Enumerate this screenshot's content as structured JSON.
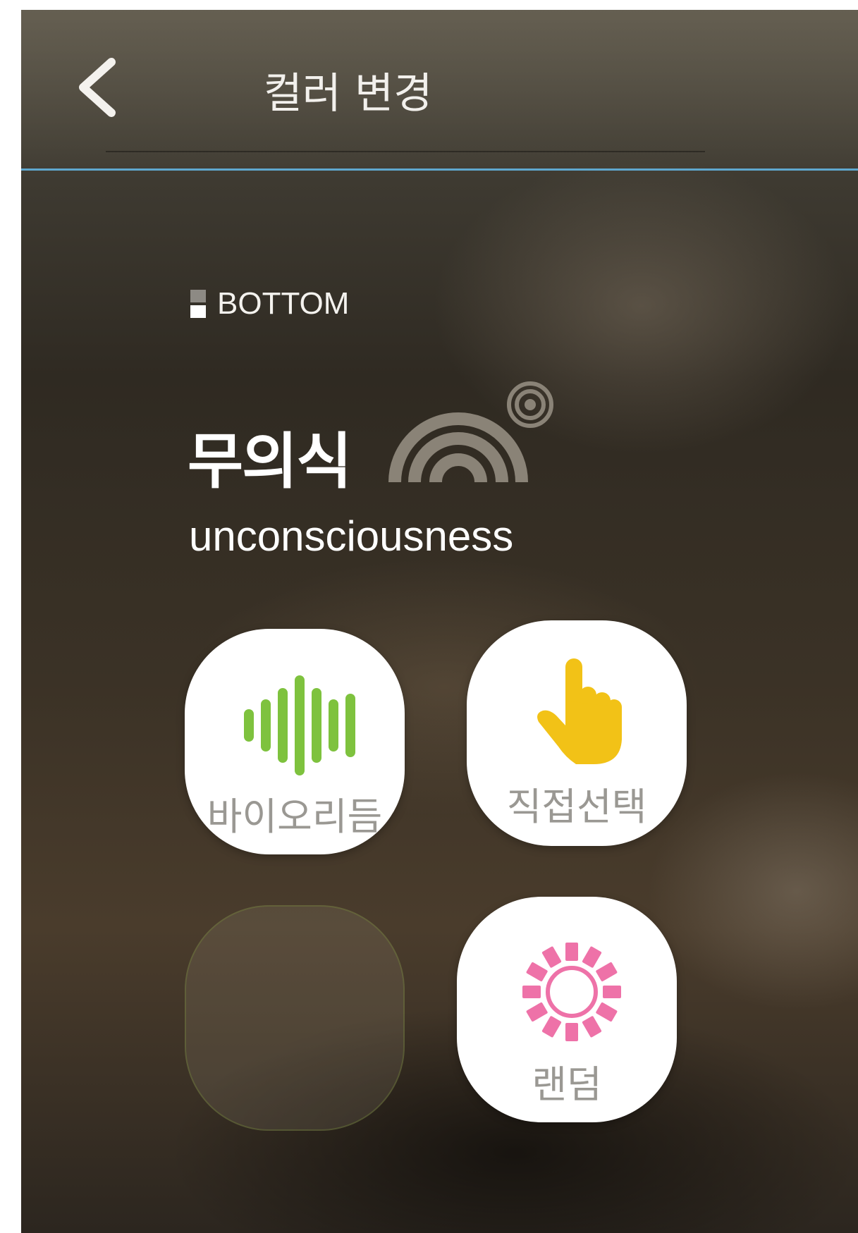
{
  "header": {
    "title": "컬러 변경",
    "back_icon": "chevron-left-icon"
  },
  "section": {
    "position_label": "BOTTOM",
    "position_icon": "bottom-half-icon"
  },
  "mode": {
    "title_ko": "무의식",
    "title_en": "unconsciousness",
    "icon": "arc-waves-icon"
  },
  "tiles": [
    {
      "label": "바이오리듬",
      "icon": "soundwave-icon",
      "icon_color": "#7ec23e"
    },
    {
      "label": "직접선택",
      "icon": "pointing-hand-icon",
      "icon_color": "#f2c217"
    },
    {
      "label": "",
      "icon": "",
      "icon_color": ""
    },
    {
      "label": "랜덤",
      "icon": "dotted-circle-icon",
      "icon_color": "#ee72a8"
    }
  ],
  "colors": {
    "accent_line": "#5fa8cf",
    "tile_label": "#9a9893"
  }
}
